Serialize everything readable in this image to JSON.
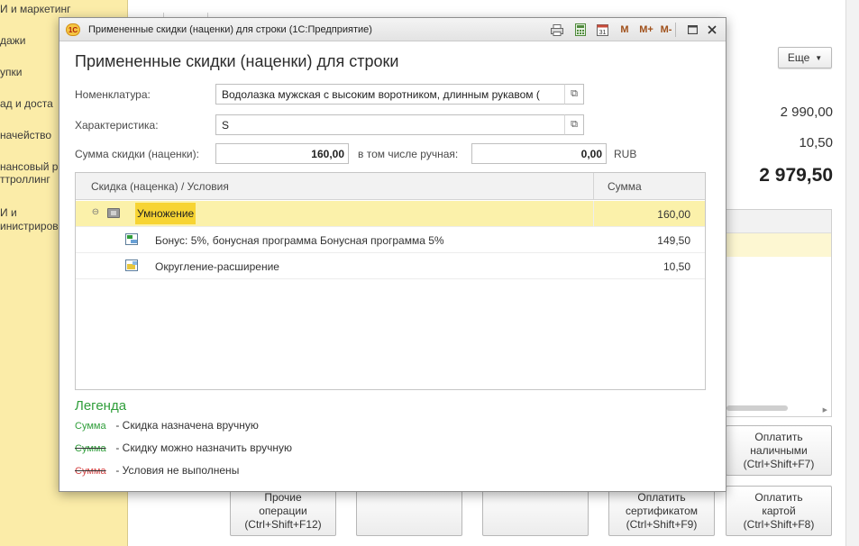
{
  "background": {
    "sidebar_items": [
      "И и маркетинг",
      "дажи",
      "упки",
      "ад и доста",
      "начейство",
      "нансовый р",
      "ттроллинг",
      "И и",
      "инистриров"
    ],
    "more_button": "Еще",
    "totals": [
      "2 990,00",
      "10,50",
      "2 979,50"
    ],
    "buttons": {
      "cash": "Оплатить\nналичными\n(Ctrl+Shift+F7)",
      "other_ops": "Прочие\nоперации\n(Ctrl+Shift+F12)",
      "certificate": "Оплатить\nсертификатом\n(Ctrl+Shift+F9)",
      "card": "Оплатить\nкартой\n(Ctrl+Shift+F8)"
    }
  },
  "dialog": {
    "window_title": "Примененные скидки (наценки) для строки  (1С:Предприятие)",
    "logo_text": "1С",
    "toolbar": {
      "m": "M",
      "m_plus": "M+",
      "m_minus": "M-"
    },
    "heading": "Примененные скидки (наценки) для строки",
    "fields": {
      "nomenclature_label": "Номенклатура:",
      "nomenclature_value": "Водолазка мужская с высоким воротником, длинным рукавом (",
      "characteristic_label": "Характеристика:",
      "characteristic_value": "S",
      "discount_sum_label": "Сумма скидки (наценки):",
      "discount_sum_value": "160,00",
      "manual_label": "в том числе ручная:",
      "manual_value": "0,00",
      "currency": "RUB"
    },
    "table": {
      "columns": [
        "Скидка (наценка) / Условия",
        "Сумма"
      ],
      "rows": [
        {
          "name": "Умножение",
          "sum": "160,00"
        },
        {
          "name": "Бонус: 5%, бонусная программа Бонусная программа 5%",
          "sum": "149,50"
        },
        {
          "name": "Округление-расширение",
          "sum": "10,50"
        }
      ]
    },
    "legend": {
      "title": "Легенда",
      "items": [
        {
          "key": "Сумма",
          "text": "- Скидка назначена вручную"
        },
        {
          "key": "Сумма",
          "text": "- Скидку можно назначить вручную"
        },
        {
          "key": "Сумма",
          "text": "- Условия не выполнены"
        }
      ]
    }
  },
  "colors": {
    "sidebar_bg": "#fbeca8",
    "selected_row": "#fbf1aa",
    "legend_green": "#2f9e3a",
    "legend_red": "#d24545"
  }
}
